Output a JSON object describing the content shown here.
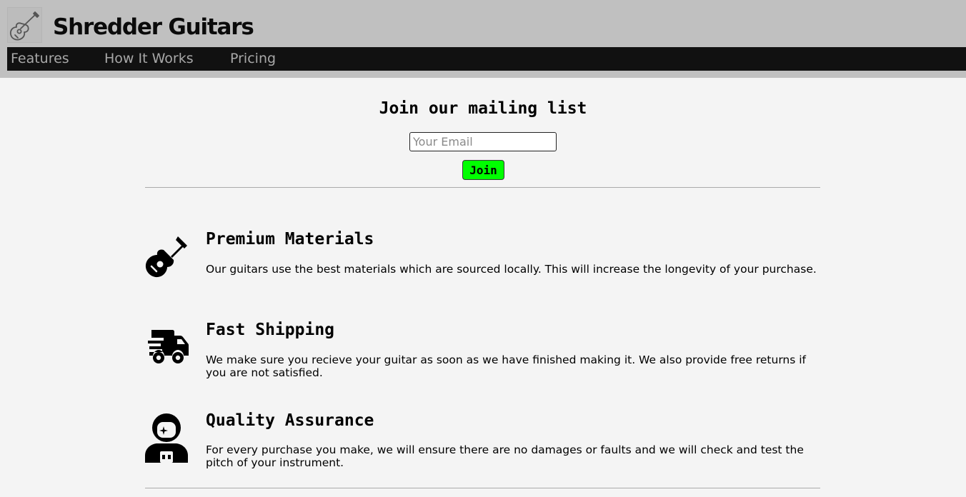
{
  "header": {
    "brand": "Shredder Guitars",
    "logo_icon": "guitar-icon"
  },
  "nav": {
    "items": [
      {
        "label": "Features"
      },
      {
        "label": "How It Works"
      },
      {
        "label": "Pricing"
      }
    ]
  },
  "mailing": {
    "title": "Join our mailing list",
    "email_placeholder": "Your Email",
    "join_label": "Join",
    "join_color": "#00ff00"
  },
  "features": [
    {
      "icon": "guitar-icon",
      "title": "Premium Materials",
      "text": "Our guitars use the best materials which are sourced locally. This will increase the longevity of your purchase."
    },
    {
      "icon": "shipping-truck-icon",
      "title": "Fast Shipping",
      "text": "We make sure you recieve your guitar as soon as we have finished making it. We also provide free returns if you are not satisfied."
    },
    {
      "icon": "astronaut-icon",
      "title": "Quality Assurance",
      "text": "For every purchase you make, we will ensure there are no damages or faults and we will check and test the pitch of your instrument."
    }
  ]
}
